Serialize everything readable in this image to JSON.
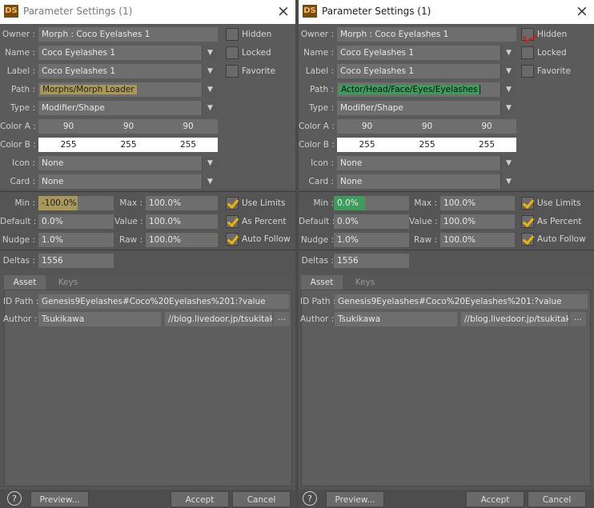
{
  "dialogs": [
    {
      "title": "Parameter Settings (1)",
      "logo": "DS",
      "close_icon": "×",
      "labels": {
        "owner": "Owner :",
        "name": "Name :",
        "label": "Label :",
        "path": "Path :",
        "type": "Type :",
        "color_a": "Color A :",
        "color_b": "Color B :",
        "icon": "Icon :",
        "card": "Card :",
        "min": "Min :",
        "max": "Max :",
        "default": "Default :",
        "value": "Value :",
        "nudge": "Nudge :",
        "raw": "Raw :",
        "deltas": "Deltas :",
        "id_path": "ID Path :",
        "author": "Author :"
      },
      "owner": "Morph : Coco Eyelashes 1",
      "name": "Coco Eyelashes 1",
      "label": "Coco Eyelashes 1",
      "path": "Morphs/Morph Loader",
      "type": "Modifier/Shape",
      "color_a": [
        "90",
        "90",
        "90"
      ],
      "color_b": [
        "255",
        "255",
        "255"
      ],
      "icon": "None",
      "card": "None",
      "hidden": {
        "label": "Hidden",
        "checked": false
      },
      "locked": {
        "label": "Locked",
        "checked": false
      },
      "favorite": {
        "label": "Favorite",
        "checked": false
      },
      "min": "-100.0%",
      "max": "100.0%",
      "default": "0.0%",
      "value": "100.0%",
      "nudge": "1.0%",
      "raw": "100.0%",
      "use_limits": {
        "label": "Use Limits",
        "checked": true
      },
      "as_percent": {
        "label": "As Percent",
        "checked": true
      },
      "auto_follow": {
        "label": "Auto Follow",
        "checked": true
      },
      "deltas": "1556",
      "tabs": [
        "Asset",
        "Keys"
      ],
      "id_path": "Genesis9Eyelashes#Coco%20Eyelashes%201:?value",
      "author": "Tsukikawa",
      "author_url": "//blog.livedoor.jp/tsukitaku/",
      "ellipsis": "...",
      "help": "?",
      "preview": "Preview...",
      "accept": "Accept",
      "cancel": "Cancel",
      "accent_path": "#a8995a"
    },
    {
      "title": "Parameter Settings (1)",
      "logo": "DS",
      "close_icon": "×",
      "labels": {
        "owner": "Owner :",
        "name": "Name :",
        "label": "Label :",
        "path": "Path :",
        "type": "Type :",
        "color_a": "Color A :",
        "color_b": "Color B :",
        "icon": "Icon :",
        "card": "Card :",
        "min": "Min :",
        "max": "Max :",
        "default": "Default :",
        "value": "Value :",
        "nudge": "Nudge :",
        "raw": "Raw :",
        "deltas": "Deltas :",
        "id_path": "ID Path :",
        "author": "Author :"
      },
      "owner": "Morph : Coco Eyelashes 1",
      "name": "Coco Eyelashes 1",
      "label": "Coco Eyelashes 1",
      "path": "Actor/Head/Face/Eyes/Eyelashes",
      "type": "Modifier/Shape",
      "color_a": [
        "90",
        "90",
        "90"
      ],
      "color_b": [
        "255",
        "255",
        "255"
      ],
      "icon": "None",
      "card": "None",
      "hidden": {
        "label": "Hidden",
        "checked": true
      },
      "locked": {
        "label": "Locked",
        "checked": false
      },
      "favorite": {
        "label": "Favorite",
        "checked": false
      },
      "min": "0.0%",
      "max": "100.0%",
      "default": "0.0%",
      "value": "100.0%",
      "nudge": "1.0%",
      "raw": "100.0%",
      "use_limits": {
        "label": "Use Limits",
        "checked": true
      },
      "as_percent": {
        "label": "As Percent",
        "checked": true
      },
      "auto_follow": {
        "label": "Auto Follow",
        "checked": true
      },
      "deltas": "1556",
      "tabs": [
        "Asset",
        "Keys"
      ],
      "id_path": "Genesis9Eyelashes#Coco%20Eyelashes%201:?value",
      "author": "Tsukikawa",
      "author_url": "//blog.livedoor.jp/tsukitaku/",
      "ellipsis": "...",
      "help": "?",
      "preview": "Preview...",
      "accept": "Accept",
      "cancel": "Cancel",
      "accent_path": "#3d9b5c"
    }
  ]
}
